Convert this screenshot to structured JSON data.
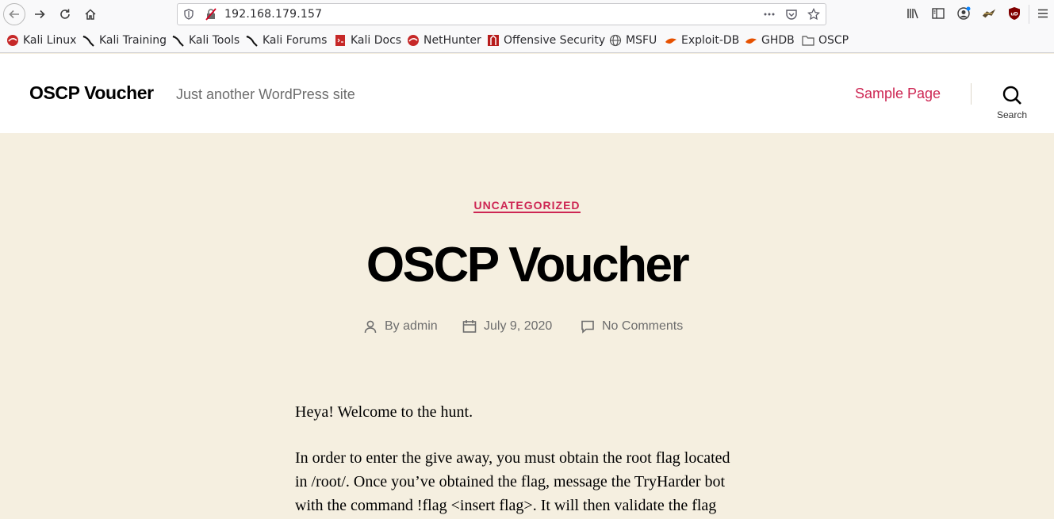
{
  "browser": {
    "url": "192.168.179.157",
    "bookmarks": [
      {
        "label": "Kali Linux",
        "icon": "kali-icon"
      },
      {
        "label": "Kali Training",
        "icon": "kali-dragon-icon"
      },
      {
        "label": "Kali Tools",
        "icon": "kali-dragon-icon"
      },
      {
        "label": "Kali Forums",
        "icon": "kali-dragon-icon"
      },
      {
        "label": "Kali Docs",
        "icon": "kali-docs-icon"
      },
      {
        "label": "NetHunter",
        "icon": "kali-icon"
      },
      {
        "label": "Offensive Security",
        "icon": "offsec-icon"
      },
      {
        "label": "MSFU",
        "icon": "globe-icon"
      },
      {
        "label": "Exploit-DB",
        "icon": "exploitdb-icon"
      },
      {
        "label": "GHDB",
        "icon": "exploitdb-icon"
      },
      {
        "label": "OSCP",
        "icon": "folder-icon"
      }
    ]
  },
  "site": {
    "title": "OSCP Voucher",
    "tagline": "Just another WordPress site",
    "nav_sample_page": "Sample Page",
    "search_label": "Search"
  },
  "post": {
    "category": "UNCATEGORIZED",
    "title": "OSCP Voucher",
    "author": "By admin",
    "date": "July 9, 2020",
    "comments": "No Comments",
    "paragraph1": "Heya! Welcome to the hunt.",
    "paragraph2_lines": [
      "In order to enter the give away, you must obtain the root flag located",
      "in /root/. Once you’ve obtained the flag, message the TryHarder bot",
      "with the command !flag <insert flag>. It will then validate the flag"
    ]
  },
  "colors": {
    "accent": "#cd2653",
    "content_bg": "#f5efe0",
    "muted_text": "#6d6d6d"
  }
}
